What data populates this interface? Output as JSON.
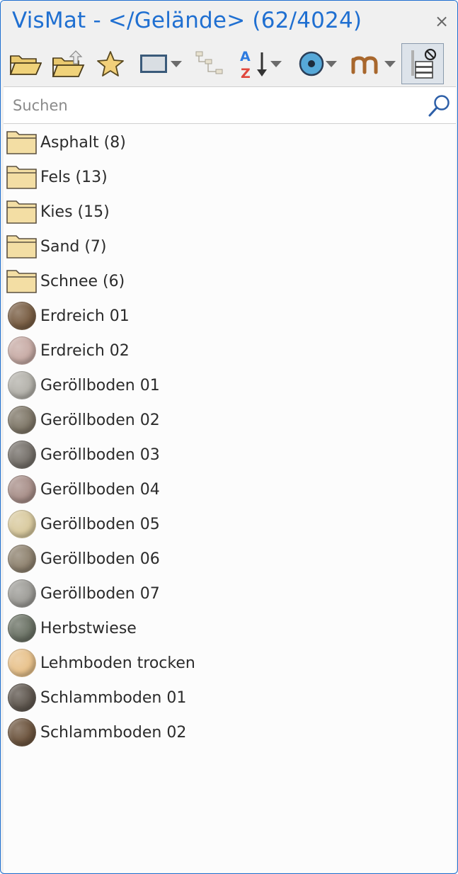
{
  "window": {
    "title": "VisMat - </Gelände> (62/4024)",
    "close_glyph": "×",
    "accent_color": "#1f6fd1"
  },
  "toolbar": {
    "buttons": [
      {
        "name": "open-folder-icon"
      },
      {
        "name": "folder-upload-icon"
      },
      {
        "name": "favorite-star-icon"
      },
      {
        "name": "view-mode-icon",
        "dropdown": true
      },
      {
        "name": "hierarchy-icon"
      },
      {
        "name": "sort-az-icon",
        "dropdown": true,
        "sort_a": "A",
        "sort_z": "Z"
      },
      {
        "name": "material-sphere-icon",
        "dropdown": true
      },
      {
        "name": "m-unit-icon",
        "dropdown": true
      },
      {
        "name": "server-filter-icon",
        "active": true
      }
    ]
  },
  "search": {
    "placeholder": "Suchen",
    "value": ""
  },
  "folders": [
    {
      "label": "Asphalt (8)"
    },
    {
      "label": "Fels (13)"
    },
    {
      "label": "Kies (15)"
    },
    {
      "label": "Sand (7)"
    },
    {
      "label": "Schnee (6)"
    }
  ],
  "materials": [
    {
      "label": "Erdreich 01",
      "color": "#7a5f45"
    },
    {
      "label": "Erdreich 02",
      "color": "#c8aca6"
    },
    {
      "label": "Geröllboden 01",
      "color": "#b4b2ab"
    },
    {
      "label": "Geröllboden 02",
      "color": "#807869"
    },
    {
      "label": "Geröllboden 03",
      "color": "#76716b"
    },
    {
      "label": "Geröllboden 04",
      "color": "#a9908a"
    },
    {
      "label": "Geröllboden 05",
      "color": "#d9ca9f"
    },
    {
      "label": "Geröllboden 06",
      "color": "#8f8370"
    },
    {
      "label": "Geröllboden 07",
      "color": "#9e9d98"
    },
    {
      "label": "Herbstwiese",
      "color": "#6c7366"
    },
    {
      "label": "Lehmboden trocken",
      "color": "#e8c28c"
    },
    {
      "label": "Schlammboden 01",
      "color": "#605850"
    },
    {
      "label": "Schlammboden 02",
      "color": "#6e5640"
    }
  ]
}
